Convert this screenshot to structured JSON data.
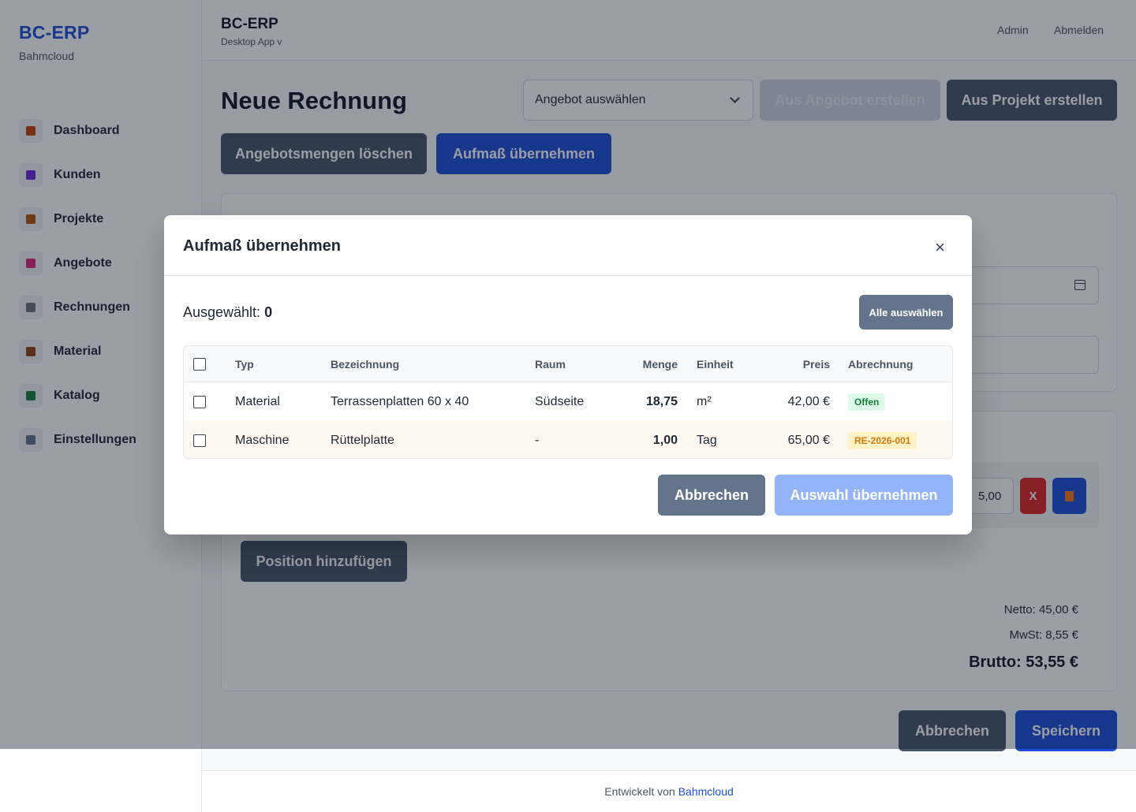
{
  "brand": {
    "title": "BC-ERP",
    "subtitle": "Bahmcloud"
  },
  "nav": [
    {
      "label": "Dashboard",
      "icon": "bar-chart-icon",
      "color": "#c2410c"
    },
    {
      "label": "Kunden",
      "icon": "users-icon",
      "color": "#6d28d9"
    },
    {
      "label": "Projekte",
      "icon": "construction-icon",
      "color": "#b45309"
    },
    {
      "label": "Angebote",
      "icon": "document-icon",
      "color": "#db2777"
    },
    {
      "label": "Rechnungen",
      "icon": "receipt-icon",
      "color": "#6b7280"
    },
    {
      "label": "Material",
      "icon": "box-icon",
      "color": "#92400e"
    },
    {
      "label": "Katalog",
      "icon": "books-icon",
      "color": "#15803d"
    },
    {
      "label": "Einstellungen",
      "icon": "gear-icon",
      "color": "#64748b"
    }
  ],
  "header": {
    "title": "BC-ERP",
    "subtitle": "Desktop App v",
    "admin": "Admin",
    "logout": "Abmelden"
  },
  "page": {
    "title": "Neue Rechnung",
    "offer_select": "Angebot auswählen",
    "from_offer": "Aus Angebot erstellen",
    "from_project": "Aus Projekt erstellen",
    "clear_offer_qty": "Angebotsmengen löschen",
    "take_measurement": "Aufmaß übernehmen",
    "position_value": "5,00",
    "delete_position": "X",
    "add_position": "Position hinzufügen",
    "netto": "Netto: 45,00 €",
    "mwst": "MwSt: 8,55 €",
    "brutto": "Brutto: 53,55 €",
    "cancel": "Abbrechen",
    "save": "Speichern"
  },
  "footer": {
    "text": "Entwickelt von",
    "link": "Bahmcloud"
  },
  "modal": {
    "title": "Aufmaß übernehmen",
    "close": "×",
    "selected_label": "Ausgewählt:",
    "selected_count": "0",
    "select_all": "Alle auswählen",
    "columns": [
      "Typ",
      "Bezeichnung",
      "Raum",
      "Menge",
      "Einheit",
      "Preis",
      "Abrechnung"
    ],
    "rows": [
      {
        "typ": "Material",
        "bezeichnung": "Terrassenplatten 60 x 40",
        "raum": "Südseite",
        "menge": "18,75",
        "einheit": "m²",
        "preis": "42,00 €",
        "abrechnung": "Offen",
        "status": "open"
      },
      {
        "typ": "Maschine",
        "bezeichnung": "Rüttelplatte",
        "raum": "-",
        "menge": "1,00",
        "einheit": "Tag",
        "preis": "65,00 €",
        "abrechnung": "RE-2026-001",
        "status": "billed"
      }
    ],
    "cancel": "Abbrechen",
    "apply": "Auswahl übernehmen"
  }
}
